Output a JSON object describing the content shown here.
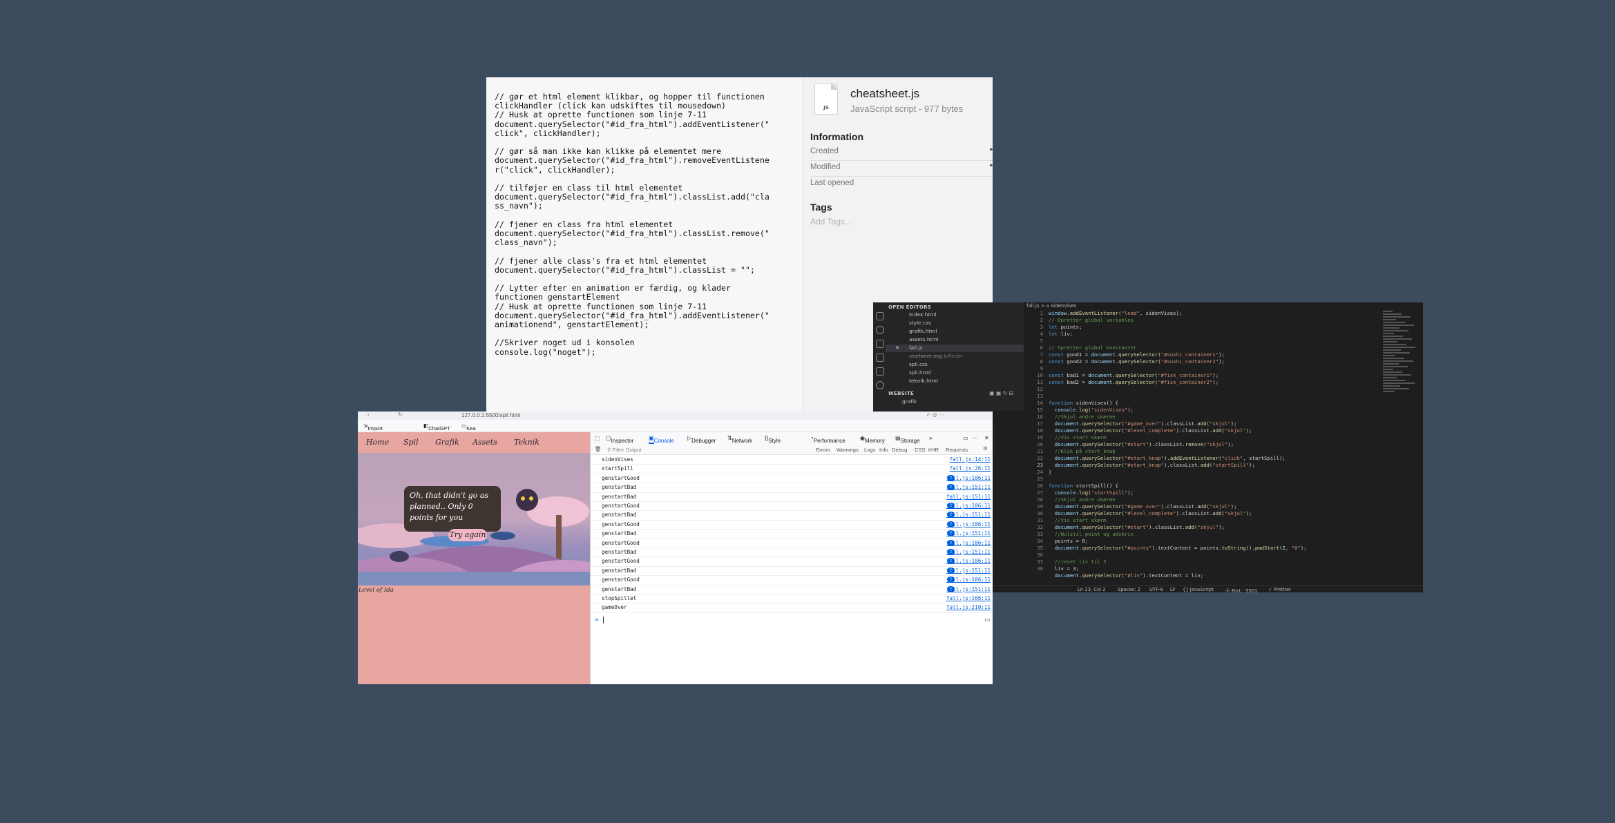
{
  "cheatsheet": {
    "code_lines": [
      "// gør et html element klikbar, og hopper til functionen",
      "clickHandler (click kan udskiftes til mousedown)",
      "// Husk at oprette functionen som linje 7-11",
      "document.querySelector(\"#id_fra_html\").addEventListener(\"",
      "click\", clickHandler);",
      "",
      "// gør så man ikke kan klikke på elementet mere",
      "document.querySelector(\"#id_fra_html\").removeEventListene",
      "r(\"click\", clickHandler);",
      "",
      "// tilføjer en class til html elementet",
      "document.querySelector(\"#id_fra_html\").classList.add(\"cla",
      "ss_navn\");",
      "",
      "// fjener en class fra html elementet",
      "document.querySelector(\"#id_fra_html\").classList.remove(\"",
      "class_navn\");",
      "",
      "// fjener alle class's fra et html elementet",
      "document.querySelector(\"#id_fra_html\").classList = \"\";",
      "",
      "// Lytter efter en animation er færdig, og klader",
      "functionen genstartElement",
      "// Husk at oprette functionen som linje 7-11",
      "document.querySelector(\"#id_fra_html\").addEventListener(\"",
      "animationend\", genstartElement);",
      "",
      "//Skriver noget ud i konsolen",
      "console.log(\"noget\");"
    ],
    "file_icon_label": "JS",
    "file_name": "cheatsheet.js",
    "file_kind": "JavaScript script - 977 bytes",
    "info_heading": "Information",
    "info_rows": [
      "Created",
      "Modified",
      "Last opened"
    ],
    "tags_heading": "Tags",
    "tags_placeholder": "Add Tags..."
  },
  "vscode": {
    "explorer": {
      "open_editors_label": "OPEN EDITORS",
      "open_editors": [
        "index.html",
        "style.css",
        "grafik.html",
        "assets.html",
        "fall.js",
        "ricetimer.svg",
        "spil.css",
        "spil.html",
        "teknik.html"
      ],
      "ricetimer_extra": "billeder",
      "website_label": "WEBSITE",
      "website_items": [
        "grafik"
      ]
    },
    "tab": "fall.js",
    "breadcrumb": "fall.js > ⌂ sidenVises",
    "line_numbers": [
      "1",
      "2",
      "3",
      "4",
      "5",
      "6",
      "7",
      "8",
      "9",
      "10",
      "11",
      "12",
      "13",
      "14",
      "15",
      "16",
      "17",
      "18",
      "19",
      "20",
      "21",
      "22",
      "23",
      "24",
      "25",
      "26",
      "27",
      "28",
      "29",
      "30",
      "31",
      "32",
      "33",
      "34",
      "35",
      "36",
      "37",
      "38"
    ],
    "code": [
      "window.addEventListener(\"load\", sidenVises);",
      "// Opretter global variables",
      "let points;",
      "let liv;",
      "",
      "// Opretter global konstanter",
      "const good1 = document.querySelector(\"#sushi_container1\");",
      "const good2 = document.querySelector(\"#sushi_container2\");",
      "",
      "const bad1 = document.querySelector(\"#fisk_container1\");",
      "const bad2 = document.querySelector(\"#fisk_container2\");",
      "",
      "",
      "function sidenVises() {",
      "  console.log(\"sidenVises\");",
      "  //Skjul andre skærme",
      "  document.querySelector(\"#game_over\").classList.add(\"skjul\");",
      "  document.querySelector(\"#level_complete\").classList.add(\"skjul\");",
      "  //Vis start skærm",
      "  document.querySelector(\"#start\").classList.remove(\"skjul\");",
      "  //Klik på start_knap",
      "  document.querySelector(\"#start_knap\").addEventListener(\"click\", startSpill);",
      "  document.querySelector(\"#start_knap\").classList.add(\"startSpill\");",
      "}",
      "",
      "function startSpill() {",
      "  console.log(\"startSpill\");",
      "  //Skjul andre skærme",
      "  document.querySelector(\"#game_over\").classList.add(\"skjul\");",
      "  document.querySelector(\"#level_complete\").classList.add(\"skjul\");",
      "  //Vis start skærm",
      "  document.querySelector(\"#start\").classList.add(\"skjul\");",
      "  //Nulstil point og udskriv",
      "  points = 0;",
      "  document.querySelector(\"#points\").textContent = points.toString().padStart(2, \"0\");",
      "",
      "  //reset liv til 3",
      "  liv = 3;",
      "  document.querySelector(\"#liv\").textContent = liv;"
    ],
    "status_items": [
      "Ln 23, Col 2",
      "Spaces: 2",
      "UTF-8",
      "LF",
      "{} JavaScript",
      "⦿ Port : 5501",
      "✓ Prettier"
    ]
  },
  "firefox": {
    "url_text": "127.0.0.1:5500/spil.html",
    "bookmarks": [
      "Import bookmarks...",
      "ChatGPT",
      "Kea web"
    ],
    "game": {
      "nav": [
        "Home",
        "Spil",
        "Grafik",
        "Assets",
        "Teknik"
      ],
      "message": "Oh, that didn't go as planned.. Only 0 points for you",
      "try_again": "Try again",
      "level_label": "Level of Ida"
    },
    "devtools": {
      "tabs": [
        "Inspector",
        "Console",
        "Debugger",
        "Network",
        "Style Editor",
        "Performance",
        "Memory",
        "Storage"
      ],
      "filter_placeholder": "Filter Output",
      "filter_buttons": [
        "Errors",
        "Warnings",
        "Logs",
        "Info",
        "Debug",
        "CSS",
        "XHR",
        "Requests"
      ],
      "console": [
        {
          "msg": "sidenVises",
          "src": "fall.js:14:11",
          "count": ""
        },
        {
          "msg": "startSpill",
          "src": "fall.js:26:11",
          "count": ""
        },
        {
          "msg": "genstartGood",
          "src": "fall.js:106:11",
          "count": "2"
        },
        {
          "msg": "genstartBad",
          "src": "fall.js:151:11",
          "count": "2"
        },
        {
          "msg": "genstartBad",
          "src": "fall.js:151:11",
          "count": ""
        },
        {
          "msg": "genstartGood",
          "src": "fall.js:106:11",
          "count": "2"
        },
        {
          "msg": "genstartBad",
          "src": "fall.js:151:11",
          "count": "2"
        },
        {
          "msg": "genstartGood",
          "src": "fall.js:106:11",
          "count": "2"
        },
        {
          "msg": "genstartBad",
          "src": "fall.js:151:11",
          "count": "2"
        },
        {
          "msg": "genstartGood",
          "src": "fall.js:106:11",
          "count": "2"
        },
        {
          "msg": "genstartBad",
          "src": "fall.js:151:11",
          "count": "2"
        },
        {
          "msg": "genstartGood",
          "src": "fall.js:106:11",
          "count": "2"
        },
        {
          "msg": "genstartBad",
          "src": "fall.js:151:11",
          "count": "2"
        },
        {
          "msg": "genstartGood",
          "src": "fall.js:106:11",
          "count": "2"
        },
        {
          "msg": "genstartBad",
          "src": "fall.js:151:11",
          "count": "2"
        },
        {
          "msg": "stopSpillet",
          "src": "fall.js:166:11",
          "count": ""
        },
        {
          "msg": "gameOver",
          "src": "fall.js:210:11",
          "count": ""
        }
      ],
      "prompt": "»"
    }
  }
}
